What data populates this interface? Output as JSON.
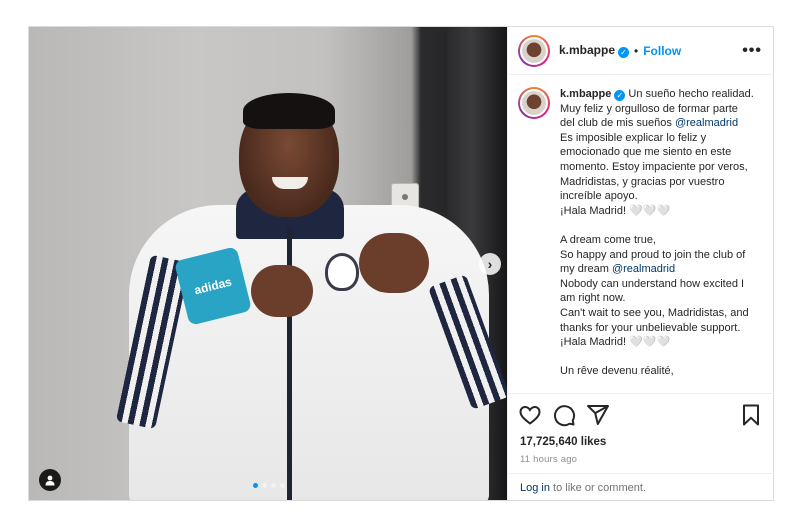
{
  "post": {
    "username": "k.mbappe",
    "separator": "•",
    "follow_label": "Follow",
    "more_label": "•••",
    "caption": {
      "username": "k.mbappe",
      "parts": [
        {
          "text": "Un sueño hecho realidad.\nMuy feliz y orgulloso de formar parte del club de mis sueños "
        },
        {
          "mention": "@realmadrid"
        },
        {
          "text": "\nEs imposible explicar lo feliz y emocionado que me siento en este momento. Estoy impaciente por veros, Madridistas, y gracias por vuestro increíble apoyo.\n¡Hala Madrid! 🤍🤍🤍\n\nA dream come true,\nSo happy and proud to join the club of my dream "
        },
        {
          "mention": "@realmadrid"
        },
        {
          "text": "\nNobody can understand how excited I am right now.\nCan't wait to see you, Madridistas, and thanks for your unbelievable support.\n¡Hala Madrid! 🤍🤍🤍\n\nUn rêve devenu réalité,"
        }
      ]
    },
    "likes": "17,725,640 likes",
    "time": "11 hours ago",
    "login": {
      "link": "Log in",
      "rest": " to like or comment."
    },
    "media": {
      "patch_text": "adidas",
      "carousel_dots": 4,
      "active_dot": 0
    },
    "icons": [
      "heart-icon",
      "comment-icon",
      "share-icon",
      "bookmark-icon",
      "chevron-right-icon",
      "user-tag-icon",
      "verified-icon"
    ],
    "colors": {
      "link": "#0095f6",
      "mention": "#00376b",
      "muted": "#8e8e8e",
      "border": "#dbdbdb"
    }
  }
}
